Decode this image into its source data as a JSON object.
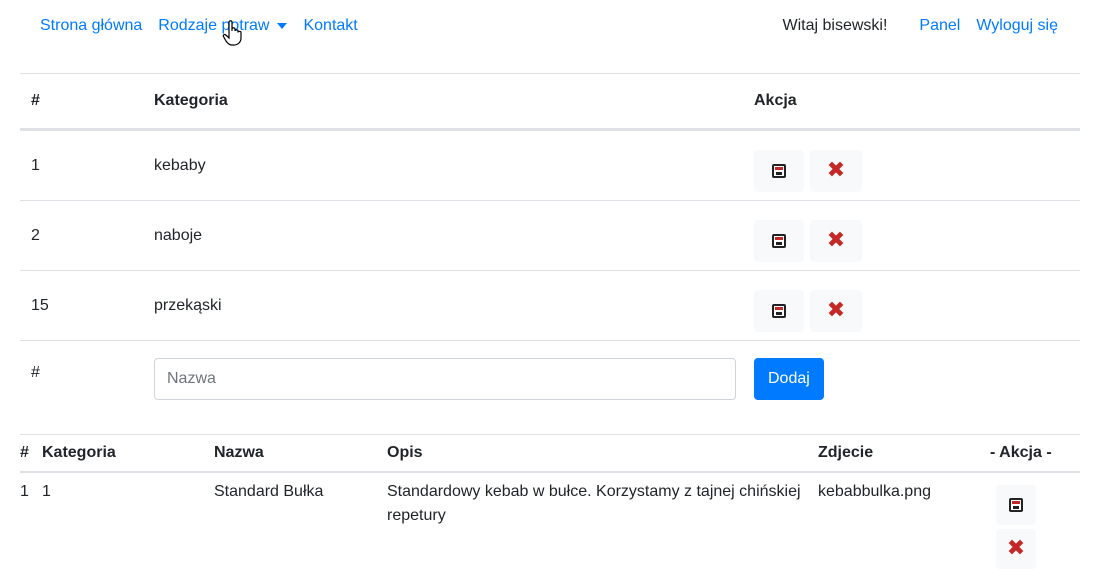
{
  "nav": {
    "home": "Strona główna",
    "dishes": "Rodzaje potraw",
    "contact": "Kontakt",
    "welcome": "Witaj bisewski!",
    "panel": "Panel",
    "logout": "Wyloguj się"
  },
  "categories": {
    "headers": [
      "#",
      "Kategoria",
      "Akcja"
    ],
    "rows": [
      {
        "id": "1",
        "name": "kebaby"
      },
      {
        "id": "2",
        "name": "naboje"
      },
      {
        "id": "15",
        "name": "przekąski"
      }
    ],
    "form": {
      "id_label": "#",
      "placeholder": "Nazwa",
      "add_label": "Dodaj"
    }
  },
  "dishes": {
    "headers": [
      "#",
      "Kategoria",
      "Nazwa",
      "Opis",
      "Zdjecie",
      "- Akcja -"
    ],
    "rows": [
      {
        "id": "1",
        "category": "1",
        "name": "Standard Bułka",
        "description": "Standardowy kebab w bułce. Korzystamy z tajnej chińskiej repetury",
        "image": "kebabbulka.png"
      }
    ]
  },
  "icons": {
    "save": "floppy-disk-icon",
    "delete": "red-x-icon"
  },
  "colors": {
    "link": "#007bff",
    "delete": "#c62828",
    "button": "#007bff"
  }
}
